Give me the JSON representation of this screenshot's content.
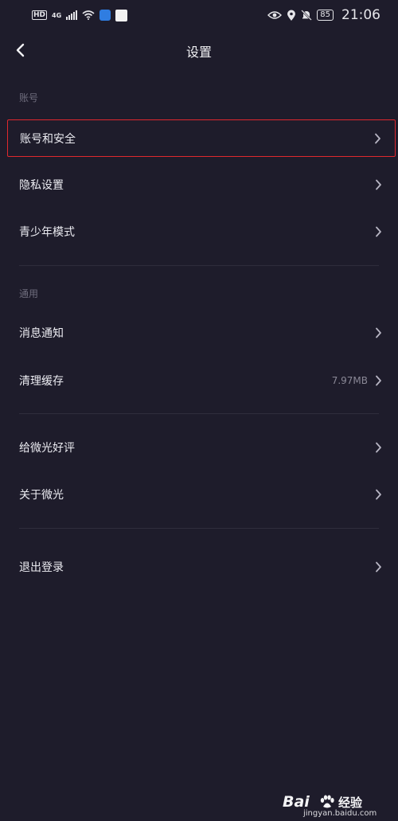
{
  "status_bar": {
    "hd": "HD",
    "network": "4G",
    "battery": "85",
    "time": "21:06",
    "icons": [
      "hd-icon",
      "signal-icon",
      "wifi-icon",
      "app-shield-icon",
      "app-news-icon",
      "eye-icon",
      "location-icon",
      "bell-off-icon",
      "battery-icon"
    ]
  },
  "header": {
    "title": "设置"
  },
  "sections": {
    "account": {
      "label": "账号",
      "items": [
        {
          "label": "账号和安全"
        },
        {
          "label": "隐私设置"
        },
        {
          "label": "青少年模式"
        }
      ]
    },
    "general": {
      "label": "通用",
      "items": [
        {
          "label": "消息通知"
        },
        {
          "label": "清理缓存",
          "value": "7.97MB"
        }
      ]
    },
    "about": {
      "items": [
        {
          "label": "给微光好评"
        },
        {
          "label": "关于微光"
        }
      ]
    },
    "logout": {
      "items": [
        {
          "label": "退出登录"
        }
      ]
    }
  },
  "watermark": {
    "logo_text": "Bai",
    "cn_text": "经验",
    "url": "jingyan.baidu.com"
  },
  "colors": {
    "background": "#1e1c2b",
    "highlight_border": "#e0282e",
    "section_label": "#6e6c7c",
    "divider": "#2f2d3c"
  }
}
